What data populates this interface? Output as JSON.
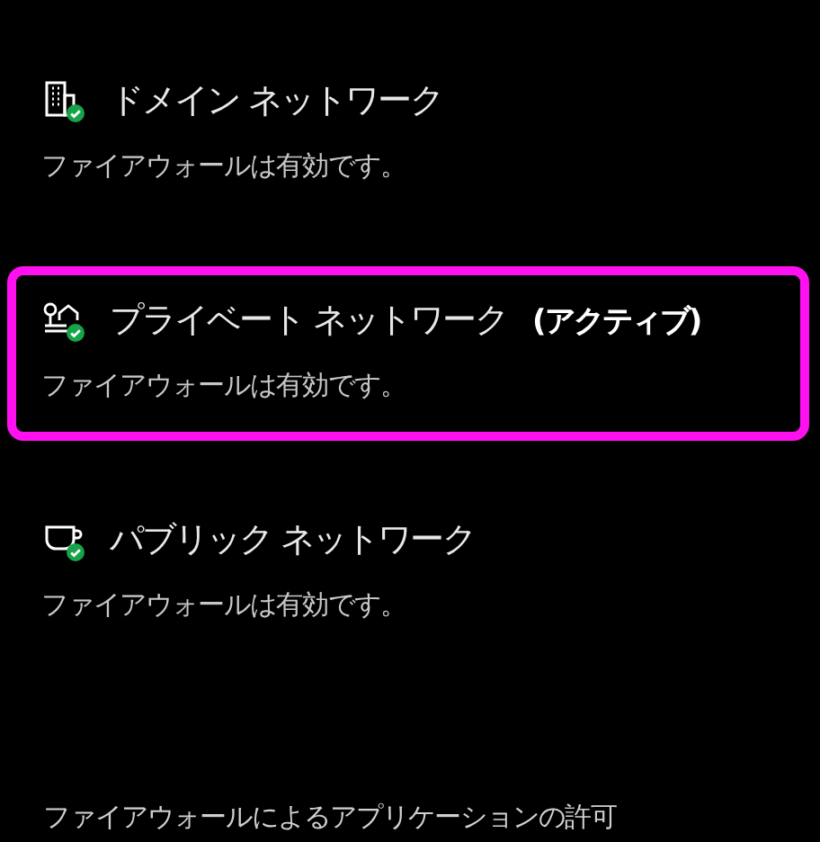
{
  "networks": [
    {
      "kind": "domain",
      "name": "ドメイン ネットワーク",
      "status_text": "ファイアウォールは有効です。",
      "selected": false
    },
    {
      "kind": "private",
      "name": "プライベート ネットワーク",
      "badge": "(アクティブ)",
      "status_text": "ファイアウォールは有効です。",
      "selected": true
    },
    {
      "kind": "public",
      "name": "パブリック ネットワーク",
      "status_text": "ファイアウォールは有効です。",
      "selected": false
    }
  ],
  "link": "ファイアウォールによるアプリケーションの許可"
}
